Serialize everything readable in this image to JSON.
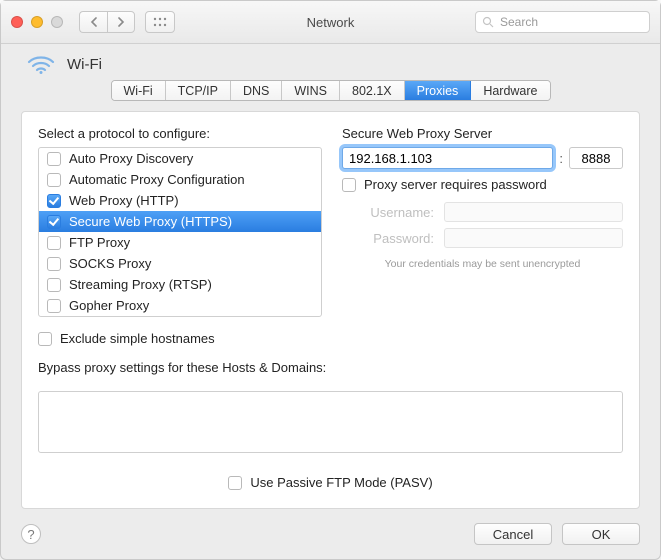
{
  "titlebar": {
    "title": "Network",
    "search_placeholder": "Search"
  },
  "header": {
    "connection_name": "Wi-Fi"
  },
  "tabs": [
    {
      "label": "Wi-Fi",
      "active": false
    },
    {
      "label": "TCP/IP",
      "active": false
    },
    {
      "label": "DNS",
      "active": false
    },
    {
      "label": "WINS",
      "active": false
    },
    {
      "label": "802.1X",
      "active": false
    },
    {
      "label": "Proxies",
      "active": true
    },
    {
      "label": "Hardware",
      "active": false
    }
  ],
  "protocols": {
    "heading": "Select a protocol to configure:",
    "items": [
      {
        "label": "Auto Proxy Discovery",
        "checked": false,
        "selected": false
      },
      {
        "label": "Automatic Proxy Configuration",
        "checked": false,
        "selected": false
      },
      {
        "label": "Web Proxy (HTTP)",
        "checked": true,
        "selected": false
      },
      {
        "label": "Secure Web Proxy (HTTPS)",
        "checked": true,
        "selected": true
      },
      {
        "label": "FTP Proxy",
        "checked": false,
        "selected": false
      },
      {
        "label": "SOCKS Proxy",
        "checked": false,
        "selected": false
      },
      {
        "label": "Streaming Proxy (RTSP)",
        "checked": false,
        "selected": false
      },
      {
        "label": "Gopher Proxy",
        "checked": false,
        "selected": false
      }
    ]
  },
  "server": {
    "heading": "Secure Web Proxy Server",
    "host": "192.168.1.103",
    "port": "8888",
    "requires_password_label": "Proxy server requires password",
    "requires_password": false,
    "username_label": "Username:",
    "username": "",
    "password_label": "Password:",
    "password": "",
    "note": "Your credentials may be sent unencrypted"
  },
  "exclude": {
    "label": "Exclude simple hostnames",
    "checked": false
  },
  "bypass": {
    "label": "Bypass proxy settings for these Hosts & Domains:",
    "value": ""
  },
  "pasv": {
    "label": "Use Passive FTP Mode (PASV)",
    "checked": false
  },
  "footer": {
    "cancel": "Cancel",
    "ok": "OK"
  }
}
